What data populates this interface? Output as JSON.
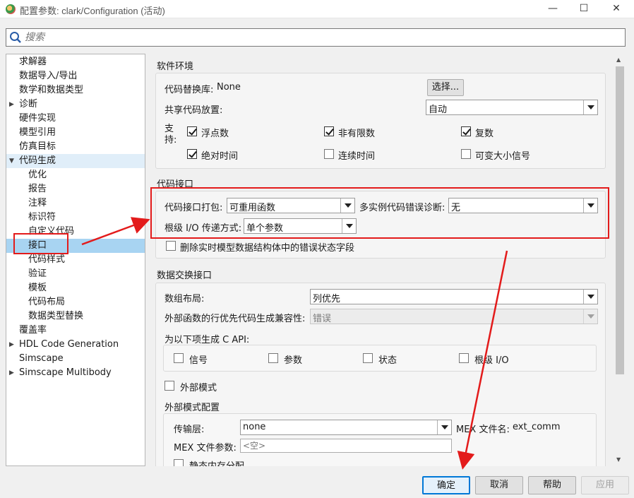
{
  "window": {
    "title": "配置参数: clark/Configuration (活动)",
    "minimize": "—",
    "maximize": "☐",
    "close": "✕"
  },
  "search": {
    "placeholder": "搜索"
  },
  "tree": [
    {
      "label": "求解器",
      "level": 1
    },
    {
      "label": "数据导入/导出",
      "level": 1
    },
    {
      "label": "数学和数据类型",
      "level": 1
    },
    {
      "label": "诊断",
      "level": 1,
      "arrow": "▶"
    },
    {
      "label": "硬件实现",
      "level": 1
    },
    {
      "label": "模型引用",
      "level": 1
    },
    {
      "label": "仿真目标",
      "level": 1
    },
    {
      "label": "代码生成",
      "level": 1,
      "arrow": "▼"
    },
    {
      "label": "优化",
      "level": 2
    },
    {
      "label": "报告",
      "level": 2
    },
    {
      "label": "注释",
      "level": 2
    },
    {
      "label": "标识符",
      "level": 2
    },
    {
      "label": "自定义代码",
      "level": 2
    },
    {
      "label": "接口",
      "level": 2
    },
    {
      "label": "代码样式",
      "level": 2
    },
    {
      "label": "验证",
      "level": 2
    },
    {
      "label": "模板",
      "level": 2
    },
    {
      "label": "代码布局",
      "level": 2
    },
    {
      "label": "数据类型替换",
      "level": 2
    },
    {
      "label": "覆盖率",
      "level": 1
    },
    {
      "label": "HDL Code Generation",
      "level": 1,
      "arrow": "▶"
    },
    {
      "label": "Simscape",
      "level": 1
    },
    {
      "label": "Simscape Multibody",
      "level": 1,
      "arrow": "▶"
    }
  ],
  "software_env": {
    "title": "软件环境",
    "code_lib_label": "代码替换库:",
    "code_lib_value": "None",
    "select_button": "选择...",
    "shared_code_label": "共享代码放置:",
    "shared_code_value": "自动",
    "support_label_1": "支",
    "support_label_2": "持:",
    "options": [
      {
        "label": "浮点数",
        "checked": true
      },
      {
        "label": "非有限数",
        "checked": true
      },
      {
        "label": "复数",
        "checked": true
      },
      {
        "label": "绝对时间",
        "checked": true
      },
      {
        "label": "连续时间",
        "checked": false
      },
      {
        "label": "可变大小信号",
        "checked": false
      }
    ]
  },
  "code_interface": {
    "title": "代码接口",
    "packaging_label": "代码接口打包:",
    "packaging_value": "可重用函数",
    "multi_instance_label": "多实例代码错误诊断:",
    "multi_instance_value": "无",
    "root_io_label": "根级 I/O 传递方式:",
    "root_io_value": "单个参数",
    "remove_error_label": "删除实时模型数据结构体中的错误状态字段",
    "remove_error_checked": false
  },
  "data_exchange": {
    "title": "数据交换接口",
    "array_layout_label": "数组布局:",
    "array_layout_value": "列优先",
    "row_major_label": "外部函数的行优先代码生成兼容性:",
    "row_major_value": "错误",
    "capi_label": "为以下项生成 C API:",
    "capi_options": [
      {
        "label": "信号",
        "checked": false
      },
      {
        "label": "参数",
        "checked": false
      },
      {
        "label": "状态",
        "checked": false
      },
      {
        "label": "根级 I/O",
        "checked": false
      }
    ],
    "external_mode_label": "外部模式",
    "external_mode_checked": false,
    "ext_config_title": "外部模式配置",
    "transport_label": "传输层:",
    "transport_value": "none",
    "mex_file_label": "MEX 文件名:",
    "mex_file_value": "ext_comm",
    "mex_args_label": "MEX 文件参数:",
    "mex_args_placeholder": "<空>",
    "static_mem_label": "静态内存分配",
    "static_mem_checked": false
  },
  "footer": {
    "ok": "确定",
    "cancel": "取消",
    "help": "帮助",
    "apply": "应用"
  },
  "annotation_color": "#e31b1b"
}
